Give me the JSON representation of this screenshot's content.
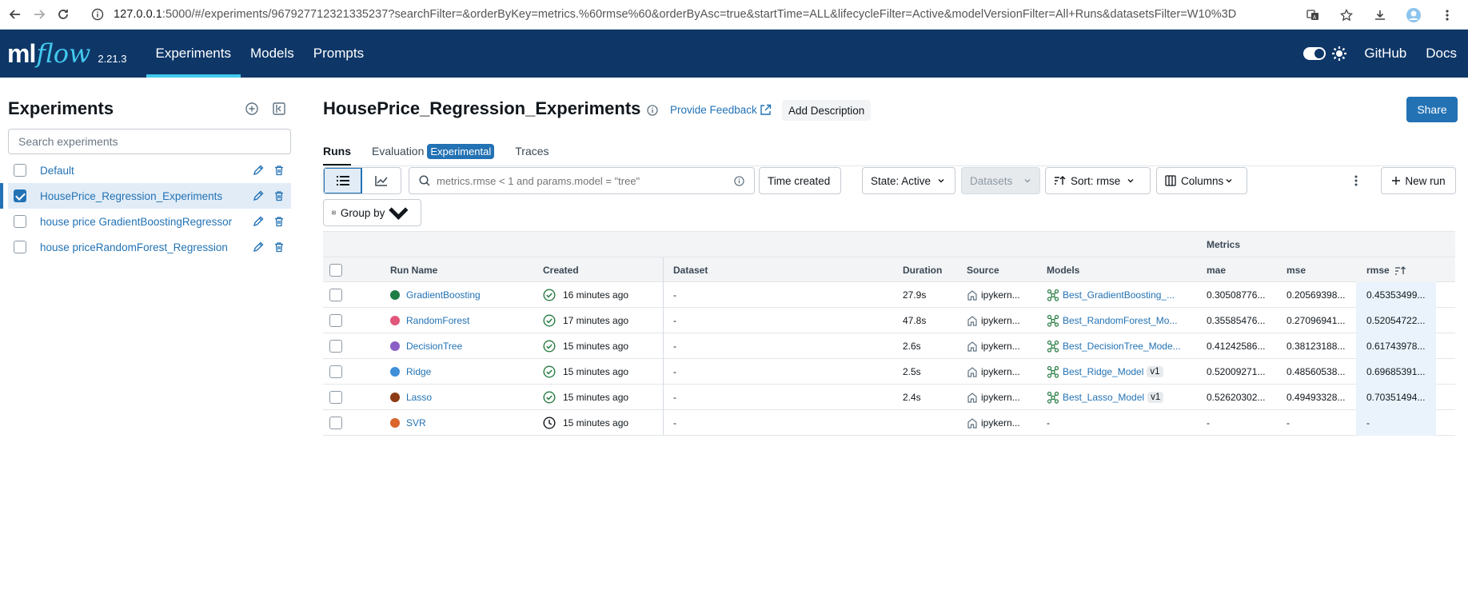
{
  "browser": {
    "url_host": "127.0.0.1",
    "url_rest": ":5000/#/experiments/967927712321335237?searchFilter=&orderByKey=metrics.%60rmse%60&orderByAsc=true&startTime=ALL&lifecycleFilter=Active&modelVersionFilter=All+Runs&datasetsFilter=W10%3D"
  },
  "topnav": {
    "logo_ml": "ml",
    "logo_flow": "flow",
    "version": "2.21.3",
    "tabs": [
      {
        "label": "Experiments",
        "active": true
      },
      {
        "label": "Models",
        "active": false
      },
      {
        "label": "Prompts",
        "active": false
      }
    ],
    "github": "GitHub",
    "docs": "Docs"
  },
  "sidebar": {
    "title": "Experiments",
    "search_placeholder": "Search experiments",
    "items": [
      {
        "label": "Default",
        "checked": false
      },
      {
        "label": "HousePrice_Regression_Experiments",
        "checked": true
      },
      {
        "label": "house price GradientBoostingRegressor",
        "checked": false
      },
      {
        "label": "house priceRandomForest_Regression",
        "checked": false
      }
    ]
  },
  "header": {
    "title": "HousePrice_Regression_Experiments",
    "feedback": "Provide Feedback",
    "add_description": "Add Description",
    "share": "Share"
  },
  "subtabs": {
    "runs": "Runs",
    "evaluation": "Evaluation",
    "experimental": "Experimental",
    "traces": "Traces"
  },
  "toolbar": {
    "search_placeholder": "metrics.rmse < 1 and params.model = \"tree\"",
    "time_created": "Time created",
    "state": "State: Active",
    "datasets": "Datasets",
    "sort": "Sort: rmse",
    "columns": "Columns",
    "new_run": "New run",
    "group_by": "Group by"
  },
  "table": {
    "metrics_group": "Metrics",
    "headers": {
      "run_name": "Run Name",
      "created": "Created",
      "dataset": "Dataset",
      "duration": "Duration",
      "source": "Source",
      "models": "Models",
      "mae": "mae",
      "mse": "mse",
      "rmse": "rmse"
    },
    "rows": [
      {
        "name": "GradientBoosting",
        "color": "#1e7d45",
        "status": "finished",
        "created": "16 minutes ago",
        "dataset": "-",
        "duration": "27.9s",
        "source": "ipykern...",
        "model": "Best_GradientBoosting_...",
        "version": "",
        "mae": "0.30508776...",
        "mse": "0.20569398...",
        "rmse": "0.45353499..."
      },
      {
        "name": "RandomForest",
        "color": "#e1577a",
        "status": "finished",
        "created": "17 minutes ago",
        "dataset": "-",
        "duration": "47.8s",
        "source": "ipykern...",
        "model": "Best_RandomForest_Mo...",
        "version": "",
        "mae": "0.35585476...",
        "mse": "0.27096941...",
        "rmse": "0.52054722..."
      },
      {
        "name": "DecisionTree",
        "color": "#8c5fc7",
        "status": "finished",
        "created": "15 minutes ago",
        "dataset": "-",
        "duration": "2.6s",
        "source": "ipykern...",
        "model": "Best_DecisionTree_Mode...",
        "version": "",
        "mae": "0.41242586...",
        "mse": "0.38123188...",
        "rmse": "0.61743978..."
      },
      {
        "name": "Ridge",
        "color": "#3f8fd9",
        "status": "finished",
        "created": "15 minutes ago",
        "dataset": "-",
        "duration": "2.5s",
        "source": "ipykern...",
        "model": "Best_Ridge_Model",
        "version": "v1",
        "mae": "0.52009271...",
        "mse": "0.48560538...",
        "rmse": "0.69685391..."
      },
      {
        "name": "Lasso",
        "color": "#8b3a12",
        "status": "finished",
        "created": "15 minutes ago",
        "dataset": "-",
        "duration": "2.4s",
        "source": "ipykern...",
        "model": "Best_Lasso_Model",
        "version": "v1",
        "mae": "0.52620302...",
        "mse": "0.49493328...",
        "rmse": "0.70351494..."
      },
      {
        "name": "SVR",
        "color": "#d9652b",
        "status": "running",
        "created": "15 minutes ago",
        "dataset": "-",
        "duration": "",
        "source": "ipykern...",
        "model": "-",
        "version": "",
        "mae": "-",
        "mse": "-",
        "rmse": "-"
      }
    ]
  },
  "colors": {
    "nav_bg": "#0e3768",
    "accent": "#2272b4",
    "logo_flow": "#43c9ed"
  }
}
